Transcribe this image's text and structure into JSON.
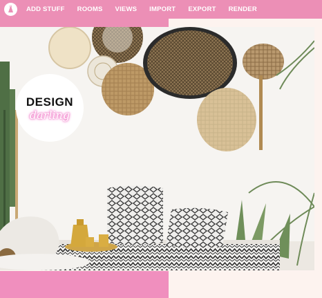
{
  "app": {
    "logo_icon": "dress-icon"
  },
  "nav": {
    "items": [
      {
        "label": "ADD STUFF"
      },
      {
        "label": "ROOMS"
      },
      {
        "label": "VIEWS"
      },
      {
        "label": "IMPORT"
      },
      {
        "label": "EXPORT"
      },
      {
        "label": "RENDER"
      }
    ]
  },
  "brand": {
    "title": "DESIGN",
    "subtitle": "darling"
  },
  "colors": {
    "nav_background": "#ec8fb6",
    "accent_pink": "#f08fbe",
    "background": "#fdf3ef"
  }
}
